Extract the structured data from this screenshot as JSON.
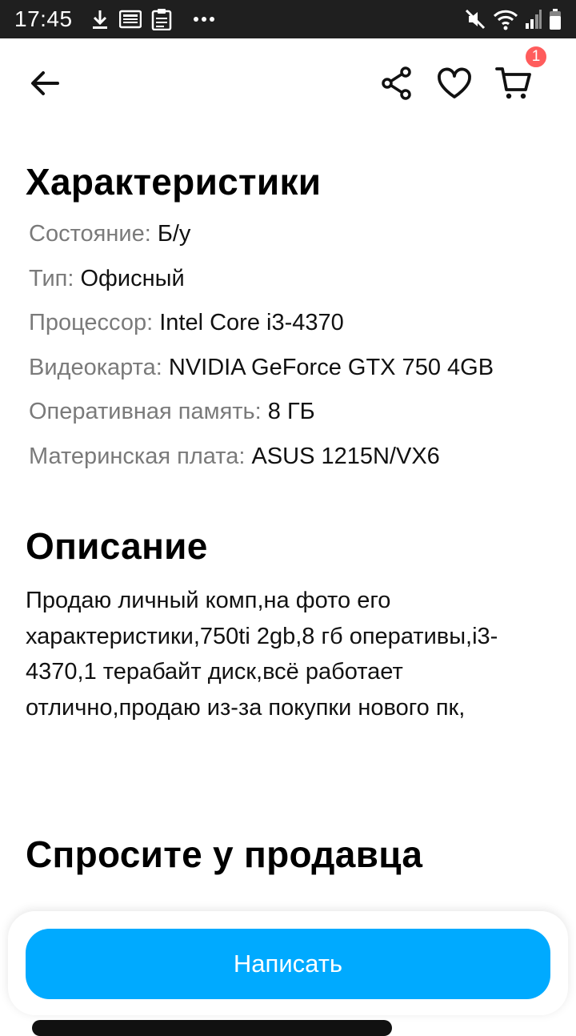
{
  "status_bar": {
    "time": "17:45",
    "left_icons": [
      "download-icon",
      "news-icon",
      "clipboard-icon",
      "more-dots-icon"
    ],
    "right_icons": [
      "mute-icon",
      "wifi-icon",
      "signal-icon",
      "battery-icon"
    ]
  },
  "app_bar": {
    "cart_badge": "1"
  },
  "specs": {
    "title": "Характеристики",
    "rows": [
      {
        "label": "Состояние:",
        "value": "Б/у"
      },
      {
        "label": "Тип:",
        "value": "Офисный"
      },
      {
        "label": "Процессор:",
        "value": "Intel Core i3-4370"
      },
      {
        "label": "Видеокарта:",
        "value": "NVIDIA GeForce GTX 750 4GB"
      },
      {
        "label": "Оперативная память:",
        "value": "8 ГБ"
      },
      {
        "label": "Материнская плата:",
        "value": "ASUS 1215N/VX6"
      }
    ]
  },
  "description": {
    "title": "Описание",
    "text": "Продаю личный комп,на фото его характеристики,750ti 2gb,8 гб оперативы,i3-4370,1 терабайт диск,всё работает отлично,продаю из-за покупки нового пк,"
  },
  "ask_seller": {
    "title": "Спросите у продавца"
  },
  "bottom": {
    "write_button_label": "Написать"
  },
  "colors": {
    "accent": "#00aaff",
    "badge": "#ff5c5c",
    "label_gray": "#7a7a7a"
  }
}
